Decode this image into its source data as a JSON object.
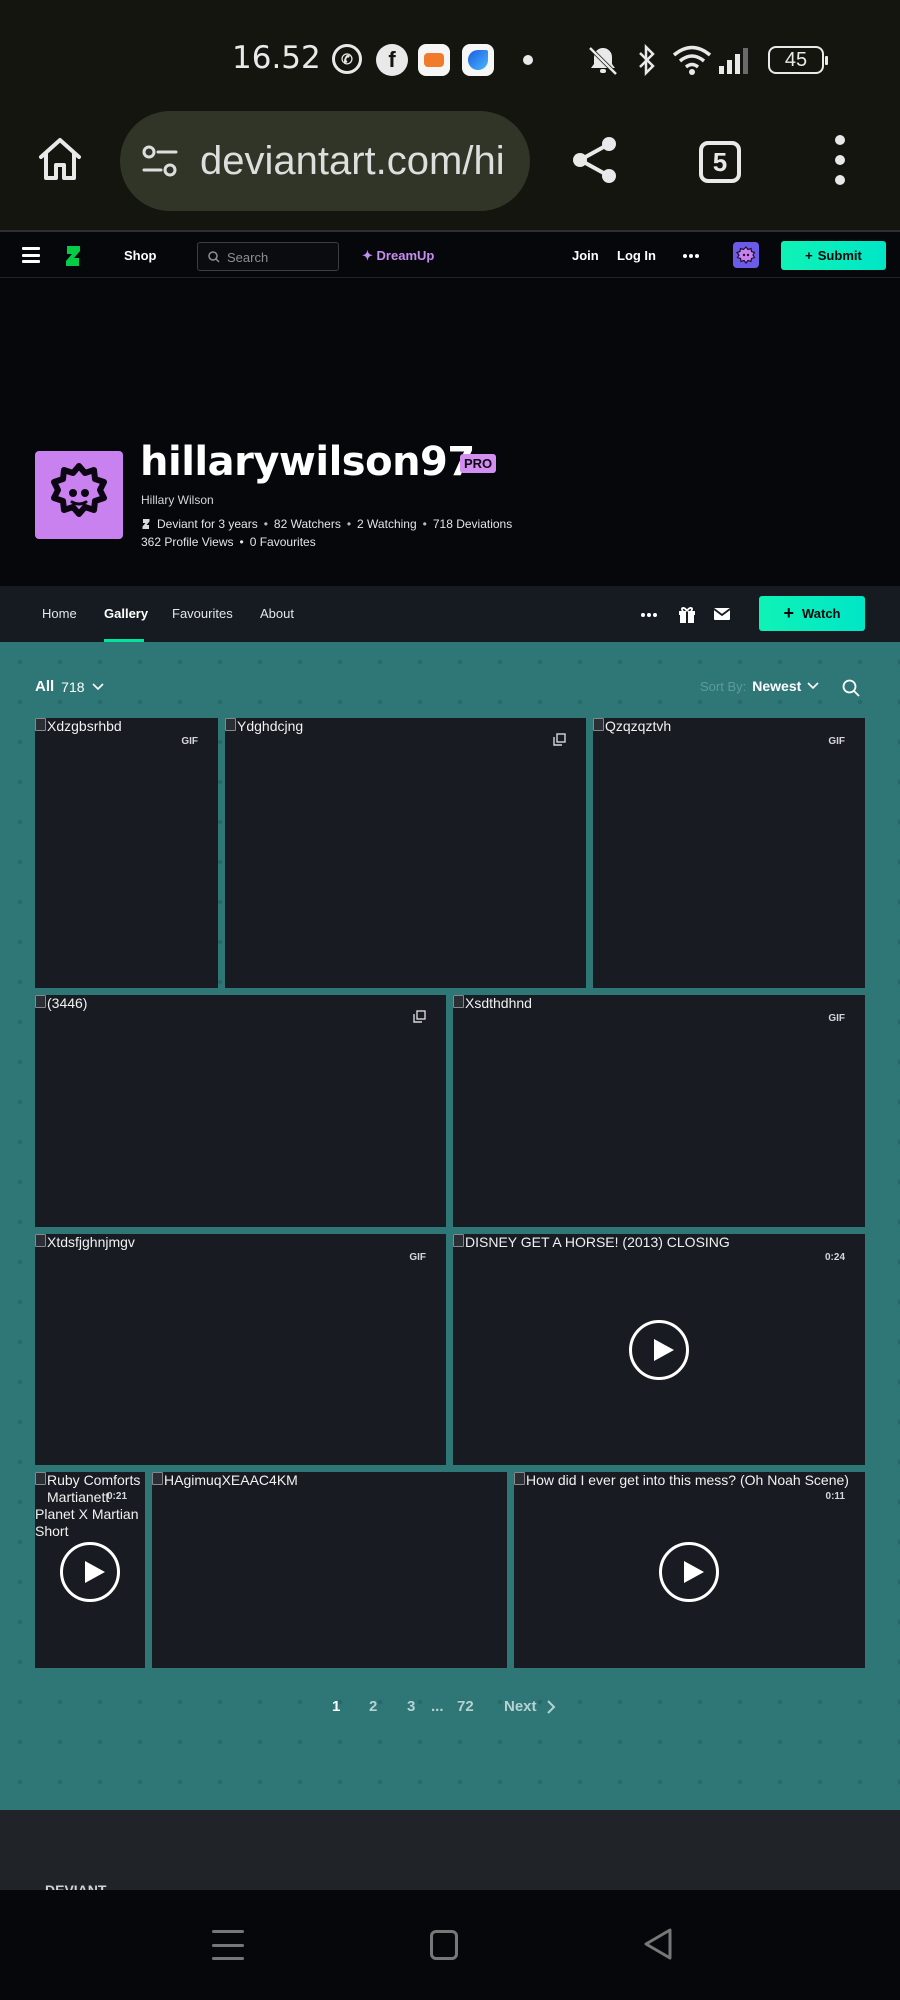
{
  "status_bar": {
    "time": "16.52",
    "battery": "45",
    "notification_icons": [
      "whatsapp-icon",
      "facebook-icon",
      "game-app-icon",
      "blue-app-icon",
      "dot-icon"
    ],
    "system_icons": [
      "mute-icon",
      "bluetooth-icon",
      "wifi-icon",
      "signal-icon",
      "battery-icon"
    ]
  },
  "browser": {
    "url": "deviantart.com/hi",
    "tab_count": "5"
  },
  "da_nav": {
    "shop": "Shop",
    "search_placeholder": "Search",
    "dreamup": "DreamUp",
    "join": "Join",
    "login": "Log In",
    "submit": "Submit"
  },
  "profile": {
    "username": "hillarywilson97",
    "badge": "PRO",
    "real_name": "Hillary Wilson",
    "stats": [
      "Deviant for 3 years",
      "82 Watchers",
      "2 Watching",
      "718 Deviations"
    ],
    "stats2": [
      "362 Profile Views",
      "0 Favourites"
    ]
  },
  "tabs": {
    "items": [
      "Home",
      "Gallery",
      "Favourites",
      "About"
    ],
    "active": "Gallery",
    "watch": "Watch"
  },
  "gallery": {
    "filter_label": "All",
    "filter_count": "718",
    "sort_label": "Sort By:",
    "sort_value": "Newest",
    "thumbs": [
      {
        "alt": "Xdzgbsrhbd",
        "badge": "GIF"
      },
      {
        "alt": "Ydghdcjng",
        "badge": "multi"
      },
      {
        "alt": "Qzqzqztvh",
        "badge": "GIF"
      },
      {
        "alt": "(3446)",
        "badge": "multi"
      },
      {
        "alt": "Xsdthdhnd",
        "badge": "GIF"
      },
      {
        "alt": "Xtdsfjghnjmgv",
        "badge": "GIF"
      },
      {
        "alt": "DISNEY GET A HORSE! (2013) CLOSING",
        "badge": "0:24"
      },
      {
        "alt": "Ruby Comforts Martianett",
        "alt2": "Planet X Martian",
        "alt3": "Short",
        "badge": "0:21"
      },
      {
        "alt": "HAgimuqXEAAC4KM",
        "badge": ""
      },
      {
        "alt": "How did I ever get into this mess? (Oh Noah Scene)",
        "badge": "0:11"
      }
    ]
  },
  "pagination": {
    "pages": [
      "1",
      "2",
      "3",
      "...",
      "72"
    ],
    "current": "1",
    "next": "Next"
  },
  "footer": {
    "text": "DEVIANT"
  }
}
